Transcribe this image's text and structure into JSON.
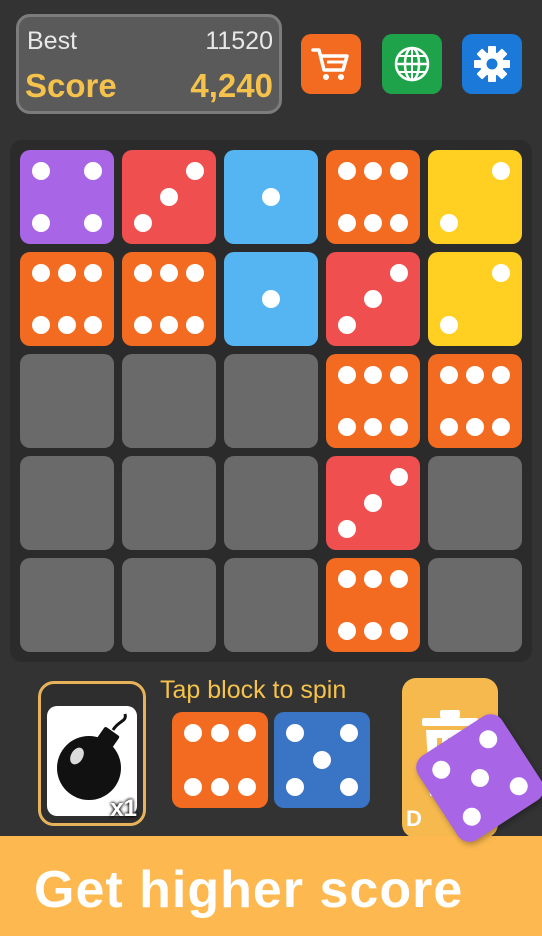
{
  "header": {
    "best_label": "Best",
    "best_value": "11520",
    "score_label": "Score",
    "score_value": "4,240",
    "buttons": [
      {
        "name": "shop",
        "icon": "cart-icon",
        "color": "#f36b21"
      },
      {
        "name": "language",
        "icon": "globe-icon",
        "color": "#1fa34a"
      },
      {
        "name": "settings",
        "icon": "gear-icon",
        "color": "#1b7ad9"
      }
    ]
  },
  "colors": {
    "background": "#333333",
    "empty_cell": "#6a6a6a",
    "accent": "#f5c24c",
    "banner": "#fdb94f",
    "die_colors": {
      "1": "#55b4f2",
      "2": "#ffd022",
      "3": "#ef4f4f",
      "4": "#a866e6",
      "5": "#3a74c4",
      "6": "#f36b21"
    }
  },
  "board": {
    "rows": 5,
    "cols": 5,
    "cells": [
      [
        4,
        3,
        1,
        6,
        2
      ],
      [
        6,
        6,
        1,
        3,
        2
      ],
      [
        0,
        0,
        0,
        6,
        6
      ],
      [
        0,
        0,
        0,
        3,
        0
      ],
      [
        0,
        0,
        0,
        6,
        0
      ]
    ]
  },
  "tray": {
    "bomb_icon": "bomb-icon",
    "bomb_count": "x1",
    "hint": "Tap block to spin",
    "next_dice": [
      6,
      5
    ],
    "discard_icon": "trash-icon",
    "discard_label": "D",
    "floating_die_value": 5,
    "floating_die_color": "#a866e6"
  },
  "banner": {
    "text": "Get higher score"
  }
}
